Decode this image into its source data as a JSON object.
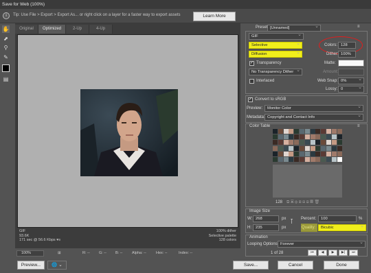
{
  "window": {
    "title": "Save for Web (100%)"
  },
  "tip": {
    "icon": "info-icon",
    "text": "Tip: Use File > Export > Export As... or right click on a layer for a faster way to export assets",
    "learn_more": "Learn More"
  },
  "tabs": [
    "Original",
    "Optimized",
    "2-Up",
    "4-Up"
  ],
  "image_info": {
    "left": [
      "GIF",
      "93.6K",
      "171 sec @ 56.6 Kbps"
    ],
    "right": [
      "100% dither",
      "Selective palette",
      "128 colors"
    ]
  },
  "status": {
    "zoom": "100%",
    "r": "R: --",
    "g": "G: --",
    "b": "B: --",
    "alpha": "Alpha: --",
    "hex": "Hex: --",
    "index": "Index: --"
  },
  "preset": {
    "label": "Preset:",
    "value": "[Unnamed]"
  },
  "format": {
    "value": "GIF"
  },
  "reduction": {
    "value": "Selective"
  },
  "dither_algo": {
    "value": "Diffusion"
  },
  "colors": {
    "label": "Colors:",
    "value": "128"
  },
  "dither": {
    "label": "Dither:",
    "value": "100%"
  },
  "transparency": {
    "label": "Transparency",
    "checked": "✓"
  },
  "matte": {
    "label": "Matte:"
  },
  "trans_dither": {
    "value": "No Transparency Dither"
  },
  "amount": {
    "label": "Amount:"
  },
  "interlaced": {
    "label": "Interlaced"
  },
  "websnap": {
    "label": "Web Snap:",
    "value": "0%"
  },
  "lossy": {
    "label": "Lossy:",
    "value": "0"
  },
  "convert": {
    "label": "Convert to sRGB",
    "checked": "✓"
  },
  "preview_row": {
    "label": "Preview:",
    "value": "Monitor Color"
  },
  "metadata": {
    "label": "Metadata:",
    "value": "Copyright and Contact Info"
  },
  "color_table": {
    "title": "Color Table",
    "count": "128"
  },
  "image_size": {
    "title": "Image Size",
    "w_label": "W:",
    "w_value": "268",
    "w_unit": "px",
    "h_label": "H:",
    "h_value": "235",
    "h_unit": "px",
    "percent_label": "Percent:",
    "percent_value": "100",
    "percent_unit": "%",
    "quality_label": "Quality:",
    "quality_value": "Bicubic"
  },
  "animation": {
    "title": "Animation",
    "looping_label": "Looping Options:",
    "looping_value": "Forever",
    "frame": "1 of 28"
  },
  "buttons": {
    "preview": "Preview...",
    "save": "Save...",
    "cancel": "Cancel",
    "done": "Done"
  },
  "colors_hl": {
    "highlight": "#f0ee1c",
    "circle": "#e51b1b"
  }
}
